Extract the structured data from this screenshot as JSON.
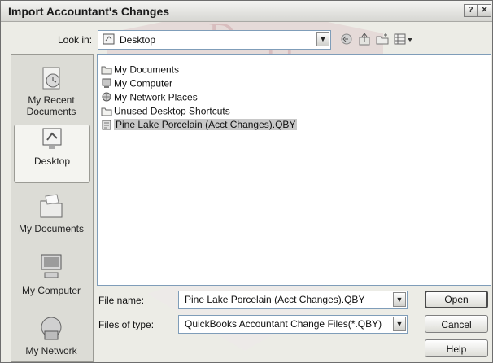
{
  "dialog": {
    "title": "Import Accountant's Changes",
    "help_glyph": "?",
    "close_glyph": "✕"
  },
  "lookin": {
    "label": "Look in:",
    "value": "Desktop"
  },
  "places": [
    {
      "label_line1": "My Recent",
      "label_line2": "Documents"
    },
    {
      "label_line1": "Desktop",
      "label_line2": ""
    },
    {
      "label_line1": "My Documents",
      "label_line2": ""
    },
    {
      "label_line1": "My Computer",
      "label_line2": ""
    },
    {
      "label_line1": "My Network",
      "label_line2": ""
    }
  ],
  "files": [
    {
      "name": "My Documents",
      "icon": "folder-documents-icon"
    },
    {
      "name": "My Computer",
      "icon": "computer-icon"
    },
    {
      "name": "My Network Places",
      "icon": "network-icon"
    },
    {
      "name": "Unused Desktop Shortcuts",
      "icon": "folder-icon"
    },
    {
      "name": "Pine Lake Porcelain (Acct Changes).QBY",
      "icon": "qby-file-icon",
      "selected": true
    }
  ],
  "filename": {
    "label": "File name:",
    "value": "Pine Lake Porcelain (Acct Changes).QBY"
  },
  "filetype": {
    "label": "Files of type:",
    "value": "QuickBooks Accountant Change Files(*.QBY)"
  },
  "buttons": {
    "open": "Open",
    "cancel": "Cancel",
    "help": "Help"
  },
  "watermark": {
    "text": "Dropp"
  }
}
